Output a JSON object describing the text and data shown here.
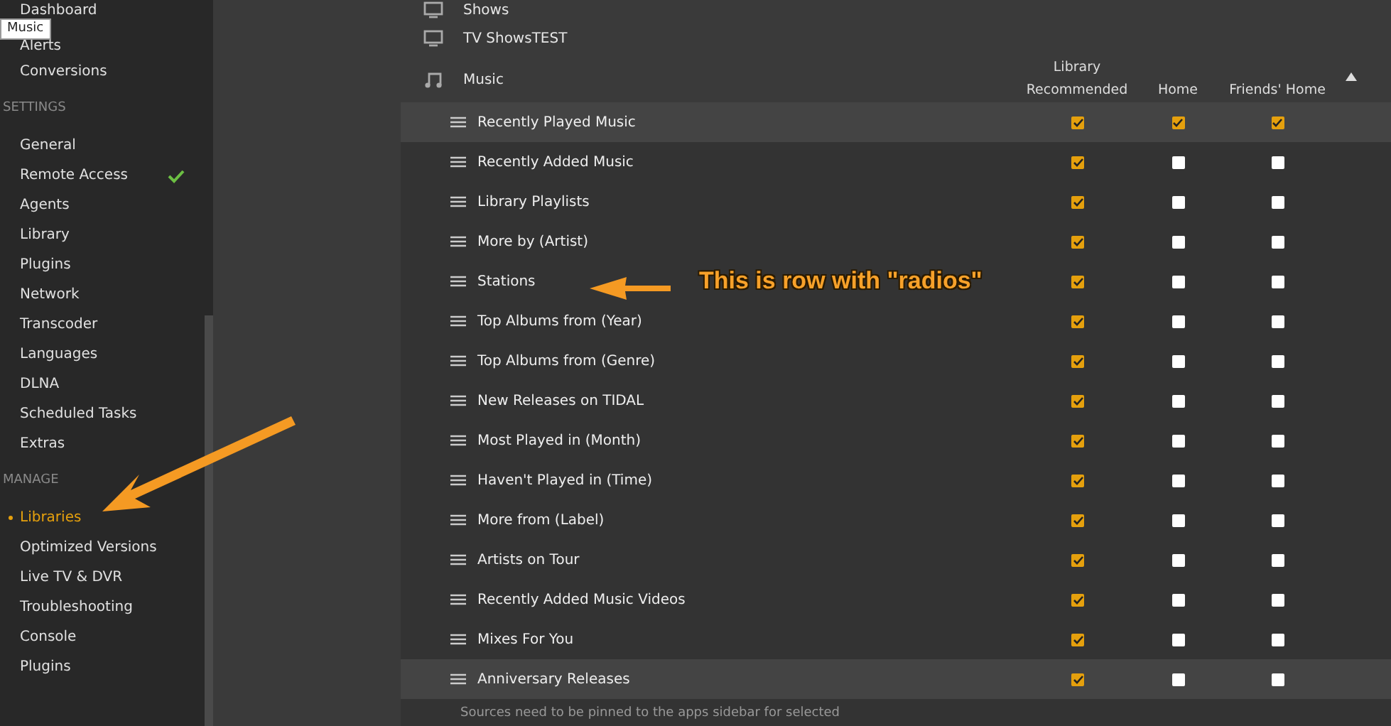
{
  "sidebar": {
    "tooltip": "Music",
    "groups": [
      {
        "items": [
          {
            "label": "Dashboard",
            "selected": false,
            "ok": false
          },
          {
            "label": "Alerts",
            "selected": false,
            "ok": false
          },
          {
            "label": "Conversions",
            "selected": false,
            "ok": false
          }
        ]
      },
      {
        "heading": "SETTINGS",
        "items": [
          {
            "label": "General",
            "selected": false,
            "ok": false
          },
          {
            "label": "Remote Access",
            "selected": false,
            "ok": true
          },
          {
            "label": "Agents",
            "selected": false,
            "ok": false
          },
          {
            "label": "Library",
            "selected": false,
            "ok": false
          },
          {
            "label": "Plugins",
            "selected": false,
            "ok": false
          },
          {
            "label": "Network",
            "selected": false,
            "ok": false
          },
          {
            "label": "Transcoder",
            "selected": false,
            "ok": false
          },
          {
            "label": "Languages",
            "selected": false,
            "ok": false
          },
          {
            "label": "DLNA",
            "selected": false,
            "ok": false
          },
          {
            "label": "Scheduled Tasks",
            "selected": false,
            "ok": false
          },
          {
            "label": "Extras",
            "selected": false,
            "ok": false
          }
        ]
      },
      {
        "heading": "MANAGE",
        "items": [
          {
            "label": "Libraries",
            "selected": true,
            "ok": false
          },
          {
            "label": "Optimized Versions",
            "selected": false,
            "ok": false
          },
          {
            "label": "Live TV & DVR",
            "selected": false,
            "ok": false
          },
          {
            "label": "Troubleshooting",
            "selected": false,
            "ok": false
          },
          {
            "label": "Console",
            "selected": false,
            "ok": false
          },
          {
            "label": "Plugins",
            "selected": false,
            "ok": false
          }
        ]
      }
    ]
  },
  "libraries": [
    {
      "name": "Shows",
      "kind": "tv"
    },
    {
      "name": "TV ShowsTEST",
      "kind": "tv"
    }
  ],
  "music": {
    "name": "Music",
    "kind": "music",
    "columns": [
      "Library Recommended",
      "Home",
      "Friends' Home"
    ],
    "rows": [
      {
        "name": "Recently Played Music",
        "hovered": true,
        "checks": [
          true,
          true,
          true
        ]
      },
      {
        "name": "Recently Added Music",
        "hovered": false,
        "checks": [
          true,
          false,
          false
        ]
      },
      {
        "name": "Library Playlists",
        "hovered": false,
        "checks": [
          true,
          false,
          false
        ]
      },
      {
        "name": "More by (Artist)",
        "hovered": false,
        "checks": [
          true,
          false,
          false
        ]
      },
      {
        "name": "Stations",
        "hovered": false,
        "checks": [
          true,
          false,
          false
        ]
      },
      {
        "name": "Top Albums from (Year)",
        "hovered": false,
        "checks": [
          true,
          false,
          false
        ]
      },
      {
        "name": "Top Albums from (Genre)",
        "hovered": false,
        "checks": [
          true,
          false,
          false
        ]
      },
      {
        "name": "New Releases on TIDAL",
        "hovered": false,
        "checks": [
          true,
          false,
          false
        ]
      },
      {
        "name": "Most Played in (Month)",
        "hovered": false,
        "checks": [
          true,
          false,
          false
        ]
      },
      {
        "name": "Haven't Played in (Time)",
        "hovered": false,
        "checks": [
          true,
          false,
          false
        ]
      },
      {
        "name": "More from (Label)",
        "hovered": false,
        "checks": [
          true,
          false,
          false
        ]
      },
      {
        "name": "Artists on Tour",
        "hovered": false,
        "checks": [
          true,
          false,
          false
        ]
      },
      {
        "name": "Recently Added Music Videos",
        "hovered": false,
        "checks": [
          true,
          false,
          false
        ]
      },
      {
        "name": "Mixes For You",
        "hovered": false,
        "checks": [
          true,
          false,
          false
        ]
      },
      {
        "name": "Anniversary Releases",
        "hovered": true,
        "checks": [
          true,
          false,
          false
        ]
      }
    ],
    "note": "Sources need to be pinned to the apps sidebar for selected"
  },
  "annotation": "This is row with \"radios\""
}
